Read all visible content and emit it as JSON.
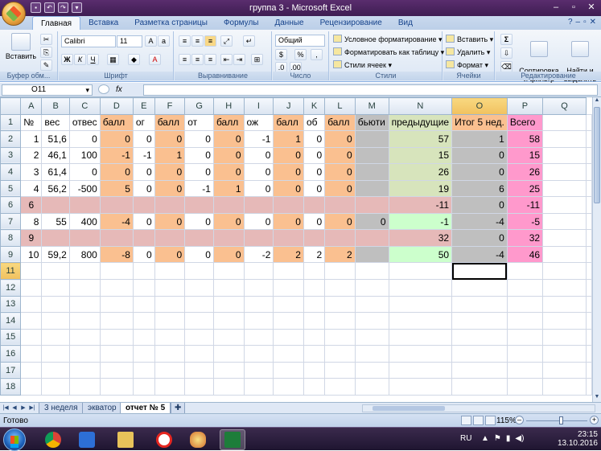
{
  "title": "группа 3 - Microsoft Excel",
  "ribbon_tabs": [
    "Главная",
    "Вставка",
    "Разметка страницы",
    "Формулы",
    "Данные",
    "Рецензирование",
    "Вид"
  ],
  "groups": {
    "clipboard": {
      "label": "Буфер обм...",
      "paste": "Вставить"
    },
    "font": {
      "label": "Шрифт",
      "name": "Calibri",
      "size": "11",
      "bold": "Ж",
      "italic": "К",
      "underline": "Ч"
    },
    "alignment": {
      "label": "Выравнивание"
    },
    "number": {
      "label": "Число",
      "format": "Общий"
    },
    "styles": {
      "label": "Стили",
      "items": [
        "Условное форматирование",
        "Форматировать как таблицу",
        "Стили ячеек"
      ]
    },
    "cells": {
      "label": "Ячейки",
      "items": [
        "Вставить",
        "Удалить",
        "Формат"
      ]
    },
    "editing": {
      "label": "Редактирование",
      "sort": "Сортировка\nи фильтр",
      "find": "Найти и\nвыделить",
      "sum": "Σ"
    }
  },
  "name_box": "O11",
  "fx_label": "fx",
  "column_headers": [
    "A",
    "B",
    "C",
    "D",
    "E",
    "F",
    "G",
    "H",
    "I",
    "J",
    "K",
    "L",
    "M",
    "N",
    "O",
    "P",
    "Q"
  ],
  "selected_column": "O",
  "selected_row": "11",
  "rows": [
    {
      "num": "1",
      "cells": [
        "№",
        "вес",
        "отвес",
        "балл",
        "ог",
        "балл",
        "от",
        "балл",
        "ож",
        "балл",
        "об",
        "балл",
        "бьюти",
        "предыдущие",
        "Итог 5 нед.",
        "Всего",
        ""
      ]
    },
    {
      "num": "2",
      "cells": [
        "1",
        "51,6",
        "0",
        "0",
        "0",
        "0",
        "0",
        "0",
        "-1",
        "1",
        "0",
        "0",
        "",
        "57",
        "1",
        "58",
        ""
      ]
    },
    {
      "num": "3",
      "cells": [
        "2",
        "46,1",
        "100",
        "-1",
        "-1",
        "1",
        "0",
        "0",
        "0",
        "0",
        "0",
        "0",
        "",
        "15",
        "0",
        "15",
        ""
      ]
    },
    {
      "num": "4",
      "cells": [
        "3",
        "61,4",
        "0",
        "0",
        "0",
        "0",
        "0",
        "0",
        "0",
        "0",
        "0",
        "0",
        "",
        "26",
        "0",
        "26",
        ""
      ]
    },
    {
      "num": "5",
      "cells": [
        "4",
        "56,2",
        "-500",
        "5",
        "0",
        "0",
        "-1",
        "1",
        "0",
        "0",
        "0",
        "0",
        "",
        "19",
        "6",
        "25",
        ""
      ]
    },
    {
      "num": "6",
      "cells": [
        "6",
        "",
        "",
        "",
        "",
        "",
        "",
        "",
        "",
        "",
        "",
        "",
        "",
        "-11",
        "0",
        "-11",
        ""
      ]
    },
    {
      "num": "7",
      "cells": [
        "8",
        "55",
        "400",
        "-4",
        "0",
        "0",
        "0",
        "0",
        "0",
        "0",
        "0",
        "0",
        "0",
        "-1",
        "-4",
        "-5",
        ""
      ]
    },
    {
      "num": "8",
      "cells": [
        "9",
        "",
        "",
        "",
        "",
        "",
        "",
        "",
        "",
        "",
        "",
        "",
        "",
        "32",
        "0",
        "32",
        ""
      ]
    },
    {
      "num": "9",
      "cells": [
        "10",
        "59,2",
        "800",
        "-8",
        "0",
        "0",
        "0",
        "0",
        "-2",
        "2",
        "2",
        "2",
        "",
        "50",
        "-4",
        "46",
        ""
      ]
    },
    {
      "num": "11",
      "cells": [
        "",
        "",
        "",
        "",
        "",
        "",
        "",
        "",
        "",
        "",
        "",
        "",
        "",
        "",
        "",
        "",
        ""
      ]
    },
    {
      "num": "12",
      "cells": [
        "",
        "",
        "",
        "",
        "",
        "",
        "",
        "",
        "",
        "",
        "",
        "",
        "",
        "",
        "",
        "",
        ""
      ]
    },
    {
      "num": "13",
      "cells": [
        "",
        "",
        "",
        "",
        "",
        "",
        "",
        "",
        "",
        "",
        "",
        "",
        "",
        "",
        "",
        "",
        ""
      ]
    },
    {
      "num": "14",
      "cells": [
        "",
        "",
        "",
        "",
        "",
        "",
        "",
        "",
        "",
        "",
        "",
        "",
        "",
        "",
        "",
        "",
        ""
      ]
    },
    {
      "num": "15",
      "cells": [
        "",
        "",
        "",
        "",
        "",
        "",
        "",
        "",
        "",
        "",
        "",
        "",
        "",
        "",
        "",
        "",
        ""
      ]
    },
    {
      "num": "16",
      "cells": [
        "",
        "",
        "",
        "",
        "",
        "",
        "",
        "",
        "",
        "",
        "",
        "",
        "",
        "",
        "",
        "",
        ""
      ]
    },
    {
      "num": "17",
      "cells": [
        "",
        "",
        "",
        "",
        "",
        "",
        "",
        "",
        "",
        "",
        "",
        "",
        "",
        "",
        "",
        "",
        ""
      ]
    },
    {
      "num": "18",
      "cells": [
        "",
        "",
        "",
        "",
        "",
        "",
        "",
        "",
        "",
        "",
        "",
        "",
        "",
        "",
        "",
        "",
        ""
      ]
    }
  ],
  "sheet_tabs": [
    "3 неделя",
    "экватор",
    "отчет № 5"
  ],
  "active_sheet": "отчет № 5",
  "status": "Готово",
  "zoom": "115%",
  "taskbar": {
    "lang": "RU",
    "time": "23:15",
    "date": "13.10.2016"
  },
  "colors": {
    "orange": "#fac090",
    "gray": "#bfbfbf",
    "light_green": "#d7e4bc",
    "pink": "#e6b9b8",
    "magenta": "#ff99cc",
    "title_bar": "#4a2560"
  }
}
